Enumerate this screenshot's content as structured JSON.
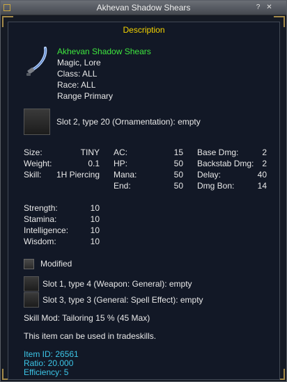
{
  "window": {
    "title": "Akhevan Shadow Shears",
    "help_glyph": "?",
    "close_glyph": "✕"
  },
  "description_header": "Description",
  "item": {
    "name": "Akhevan Shadow Shears",
    "flags": "Magic, Lore",
    "class": "Class:  ALL",
    "race": "Race:  ALL",
    "slot": "Range Primary"
  },
  "ornament_slot": "Slot 2, type 20 (Ornamentation): empty",
  "stats_left": [
    {
      "label": "Size:",
      "value": "TINY"
    },
    {
      "label": "Weight:",
      "value": "0.1"
    },
    {
      "label": "Skill:",
      "value": "1H Piercing"
    }
  ],
  "stats_mid": [
    {
      "label": "AC:",
      "value": "15"
    },
    {
      "label": "HP:",
      "value": "50"
    },
    {
      "label": "Mana:",
      "value": "50"
    },
    {
      "label": "End:",
      "value": "50"
    }
  ],
  "stats_right": [
    {
      "label": "Base Dmg:",
      "value": "2"
    },
    {
      "label": "Backstab Dmg:",
      "value": "2"
    },
    {
      "label": "Delay:",
      "value": "40"
    },
    {
      "label": "Dmg Bon:",
      "value": "14"
    }
  ],
  "attributes": [
    {
      "label": "Strength:",
      "value": "10"
    },
    {
      "label": "Stamina:",
      "value": "10"
    },
    {
      "label": "Intelligence:",
      "value": "10"
    },
    {
      "label": "Wisdom:",
      "value": "10"
    }
  ],
  "modified_label": "Modified",
  "aug_slots": [
    "Slot 1, type 4 (Weapon: General): empty",
    "Slot 3, type 3 (General: Spell Effect): empty"
  ],
  "skill_mod": "Skill Mod: Tailoring 15 % (45 Max)",
  "tradeskill_note": "This item can be used in tradeskills.",
  "footer": {
    "item_id": "Item ID: 26561",
    "ratio": "Ratio: 20.000",
    "efficiency": "Efficiency: 5"
  },
  "icons": {
    "item": "sickle-icon",
    "lock": "lock-icon",
    "help": "help-icon",
    "close": "close-icon"
  },
  "colors": {
    "name_green": "#3ee63e",
    "header_yellow": "#f5d400",
    "footer_cyan": "#3cc6e8"
  }
}
